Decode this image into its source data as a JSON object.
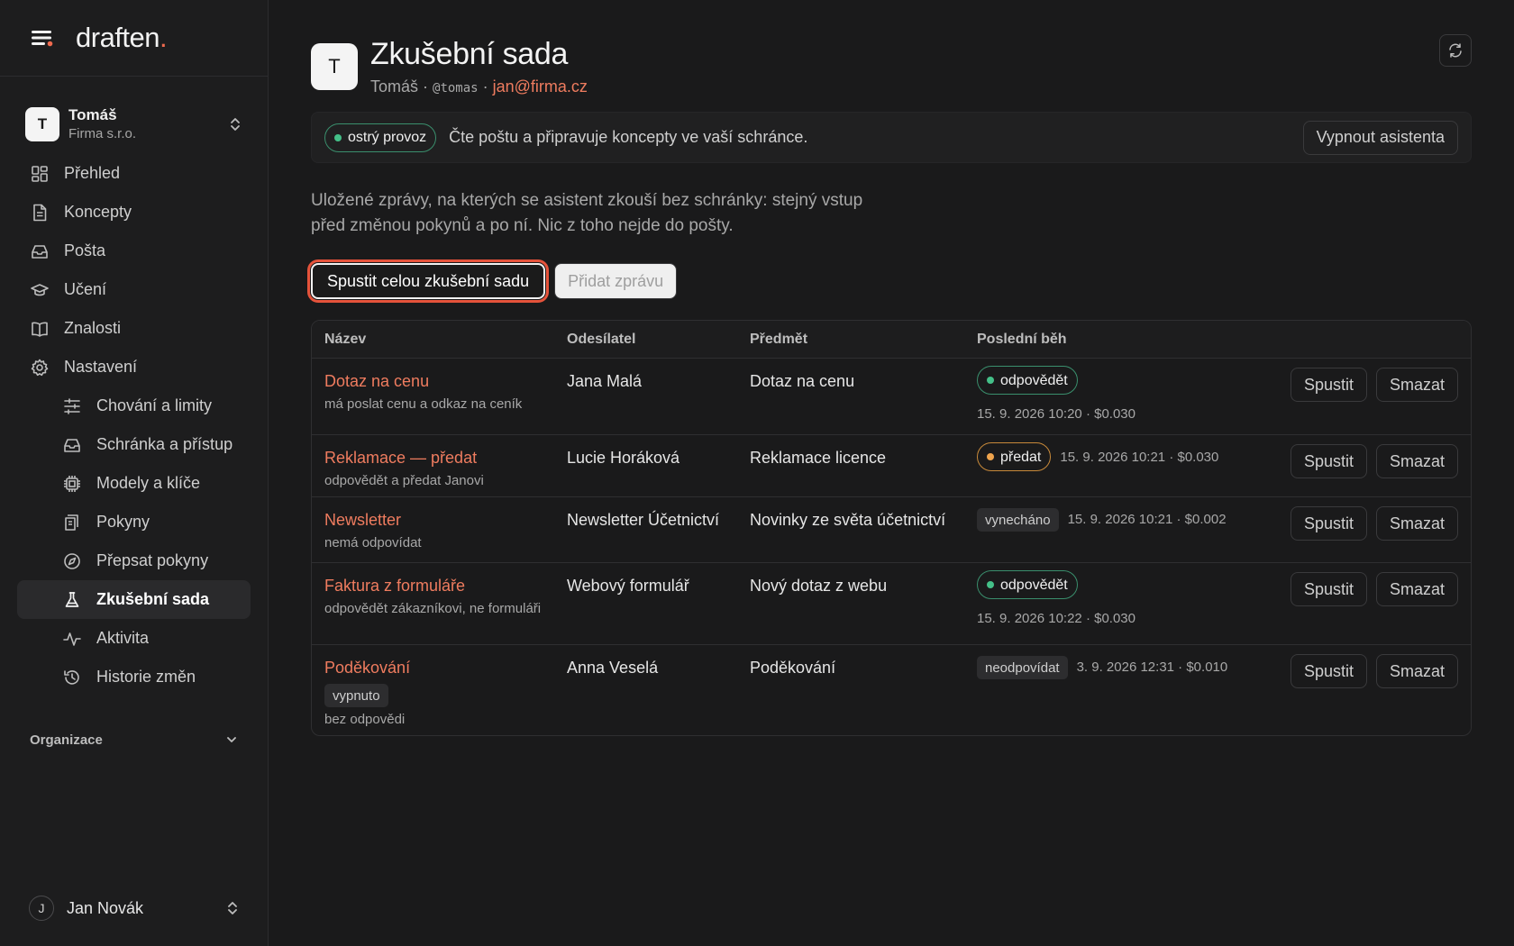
{
  "brand": {
    "name": "draften",
    "dot": "."
  },
  "org": {
    "avatar": "T",
    "name": "Tomáš",
    "company": "Firma s.r.o."
  },
  "nav": {
    "items": [
      {
        "label": "Přehled",
        "icon": "dashboard-icon"
      },
      {
        "label": "Koncepty",
        "icon": "document-icon"
      },
      {
        "label": "Pošta",
        "icon": "inbox-icon"
      },
      {
        "label": "Učení",
        "icon": "graduation-cap-icon"
      },
      {
        "label": "Znalosti",
        "icon": "book-icon"
      },
      {
        "label": "Nastavení",
        "icon": "gear-icon"
      }
    ],
    "sub_items": [
      {
        "label": "Chování a limity",
        "icon": "sliders-icon"
      },
      {
        "label": "Schránka a přístup",
        "icon": "inbox-icon"
      },
      {
        "label": "Modely a klíče",
        "icon": "chip-icon"
      },
      {
        "label": "Pokyny",
        "icon": "scroll-icon"
      },
      {
        "label": "Přepsat pokyny",
        "icon": "compass-icon"
      },
      {
        "label": "Zkušební sada",
        "icon": "flask-icon",
        "active": true
      },
      {
        "label": "Aktivita",
        "icon": "activity-icon"
      },
      {
        "label": "Historie změn",
        "icon": "history-icon"
      }
    ]
  },
  "org_section": {
    "label": "Organizace"
  },
  "user": {
    "avatar": "J",
    "name": "Jan Novák"
  },
  "page": {
    "avatar": "T",
    "title": "Zkušební sada",
    "owner": "Tomáš",
    "sep": " · ",
    "handle": "@tomas",
    "email": "jan@firma.cz"
  },
  "status": {
    "badge": "ostrý provoz",
    "text": "Čte poštu a připravuje koncepty ve vaší schránce.",
    "button": "Vypnout asistenta"
  },
  "description": "Uložené zprávy, na kterých se asistent zkouší bez schránky: stejný vstup před změnou pokynů a po ní. Nic z toho nejde do pošty.",
  "actions": {
    "run_all": "Spustit celou zkušební sadu",
    "add": "Přidat zprávu"
  },
  "table": {
    "headers": {
      "name": "Název",
      "sender": "Odesílatel",
      "subject": "Předmět",
      "last_run": "Poslední běh"
    },
    "run_label": "Spustit",
    "delete_label": "Smazat",
    "rows": [
      {
        "name": "Dotaz na cenu",
        "tag": "",
        "desc": "má poslat cenu a odkaz na ceník",
        "sender": "Jana Malá",
        "subject": "Dotaz na cenu",
        "result": "odpovědět",
        "result_style": "green",
        "meta": "15. 9. 2026 10:20 · $0.030",
        "meta_layout": "block"
      },
      {
        "name": "Reklamace — předat",
        "tag": "",
        "desc": "odpovědět a předat Janovi",
        "sender": "Lucie Horáková",
        "subject": "Reklamace licence",
        "result": "předat",
        "result_style": "amber",
        "meta": "15. 9. 2026 10:21 · $0.030",
        "meta_layout": "inline"
      },
      {
        "name": "Newsletter",
        "tag": "",
        "desc": "nemá odpovídat",
        "sender": "Newsletter Účetnictví",
        "subject": "Novinky ze světa účetnictví",
        "result": "vynecháno",
        "result_style": "plain",
        "meta": "15. 9. 2026 10:21 · $0.002",
        "meta_layout": "inline"
      },
      {
        "name": "Faktura z formuláře",
        "tag": "",
        "desc": "odpovědět zákazníkovi, ne formuláři",
        "sender": "Webový formulář",
        "subject": "Nový dotaz z webu",
        "result": "odpovědět",
        "result_style": "green",
        "meta": "15. 9. 2026 10:22 · $0.030",
        "meta_layout": "block"
      },
      {
        "name": "Poděkování",
        "tag": "vypnuto",
        "desc": "bez odpovědi",
        "sender": "Anna Veselá",
        "subject": "Poděkování",
        "result": "neodpovídat",
        "result_style": "plain",
        "meta": "3. 9. 2026 12:31 · $0.010",
        "meta_layout": "inline"
      }
    ]
  },
  "colors": {
    "accent": "#ef7c5f",
    "brand_dot": "#ef6a4f",
    "focus_ring": "#e5533b",
    "ok": "#44c088",
    "warn": "#efa44d",
    "background": "#1a1a1b"
  }
}
